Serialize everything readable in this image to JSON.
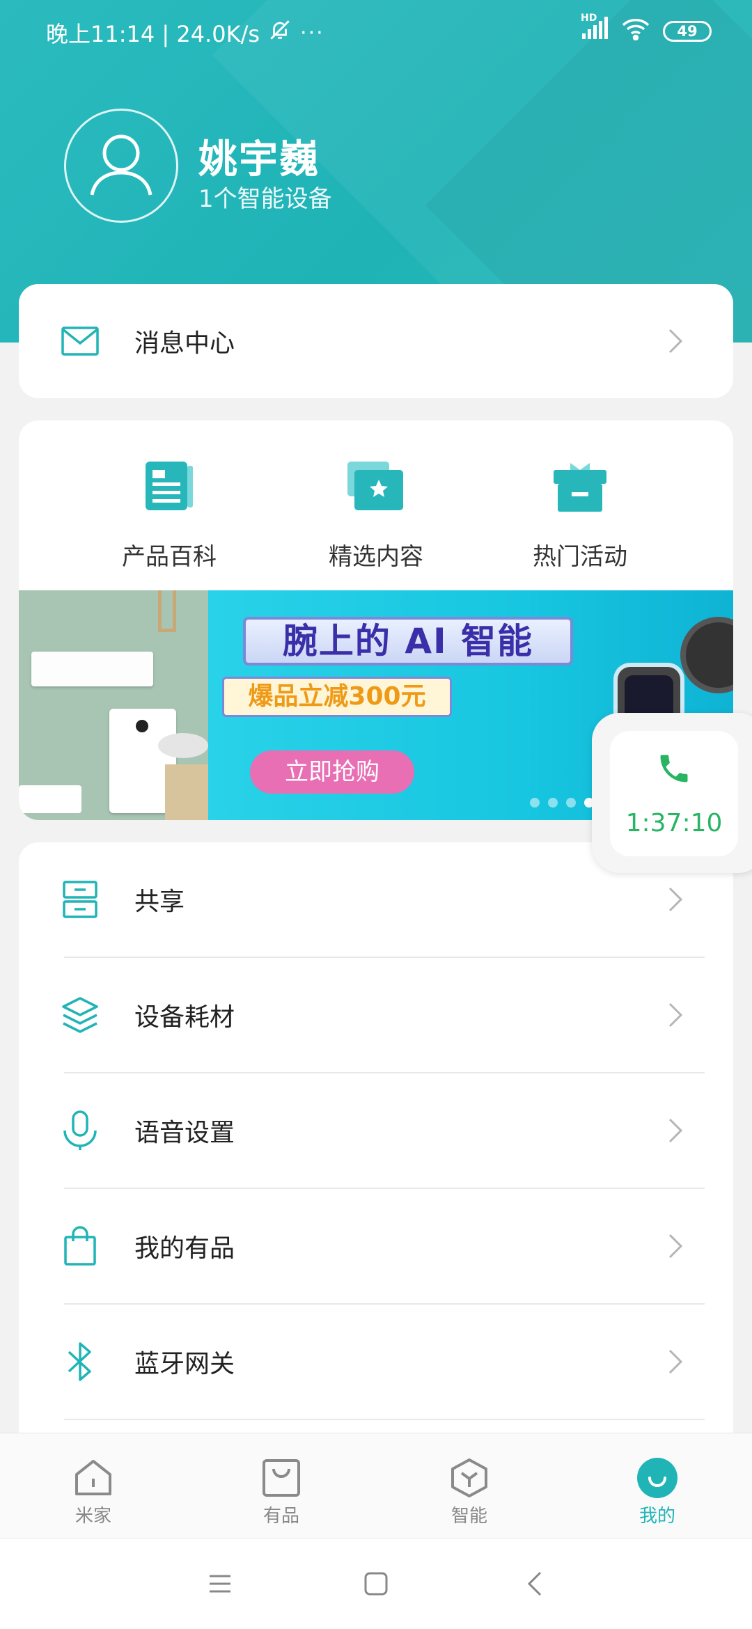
{
  "status_bar": {
    "time_speed": "晚上11:14 | 24.0K/s",
    "more": "···",
    "network": "HD",
    "battery": "49"
  },
  "profile": {
    "name": "姚宇巍",
    "device_count": "1个智能设备"
  },
  "message_center": {
    "label": "消息中心"
  },
  "quick_links": [
    {
      "label": "产品百科",
      "icon": "encyclopedia-icon"
    },
    {
      "label": "精选内容",
      "icon": "featured-star-icon"
    },
    {
      "label": "热门活动",
      "icon": "gift-icon"
    }
  ],
  "banner": {
    "title": "腕上的 AI 智能",
    "subtitle": "爆品立减300元",
    "button": "立即抢购",
    "slide_count": 4,
    "active_slide": 4
  },
  "call_widget": {
    "duration": "1:37:10",
    "icon": "phone-icon"
  },
  "menu": [
    {
      "label": "共享",
      "icon": "share-icon"
    },
    {
      "label": "设备耗材",
      "icon": "layers-icon"
    },
    {
      "label": "语音设置",
      "icon": "microphone-icon"
    },
    {
      "label": "我的有品",
      "icon": "shopping-bag-icon"
    },
    {
      "label": "蓝牙网关",
      "icon": "bluetooth-icon"
    }
  ],
  "tabs": [
    {
      "label": "米家",
      "icon": "home-icon",
      "active": false
    },
    {
      "label": "有品",
      "icon": "store-bag-icon",
      "active": false
    },
    {
      "label": "智能",
      "icon": "smart-cube-icon",
      "active": false
    },
    {
      "label": "我的",
      "icon": "profile-smile-icon",
      "active": true
    }
  ],
  "colors": {
    "accent": "#21b4b6",
    "header": "#24b7b9",
    "call_green": "#28b463"
  }
}
